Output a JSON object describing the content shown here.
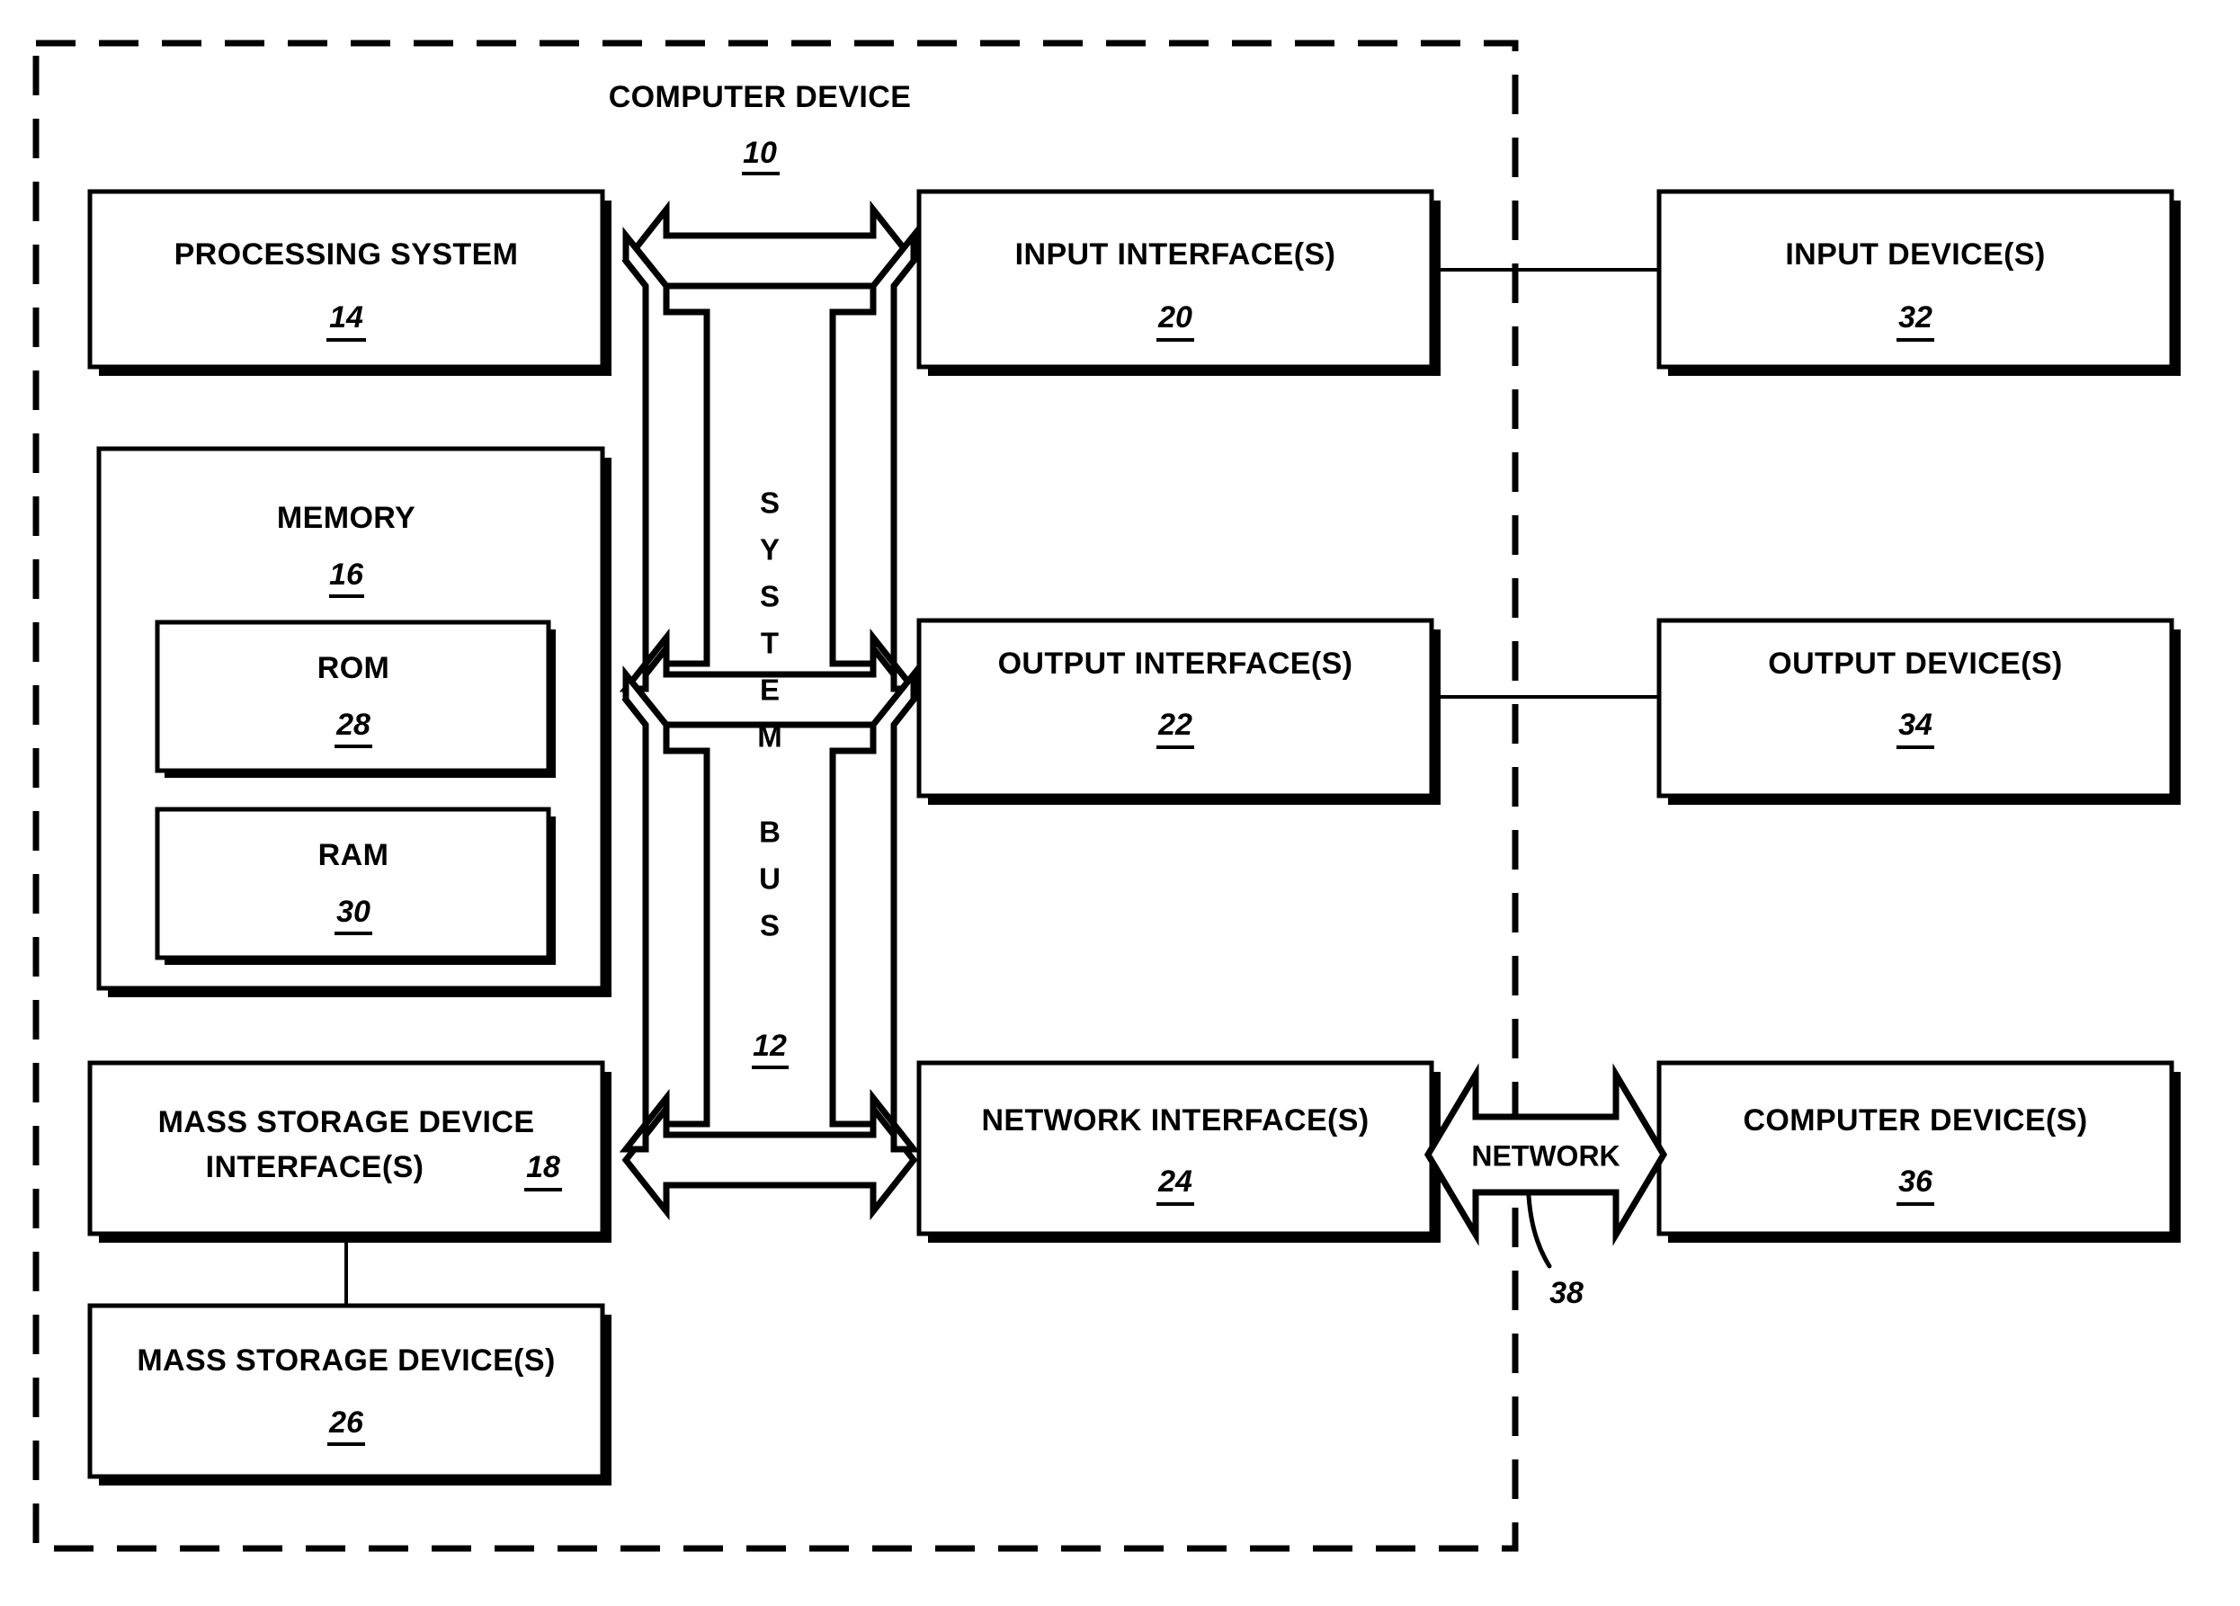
{
  "figure": {
    "title": "COMPUTER DEVICE",
    "title_ref": "10",
    "bus": {
      "label_letters": [
        "S",
        "Y",
        "S",
        "T",
        "E",
        "M",
        "",
        "B",
        "U",
        "S"
      ],
      "label_text": "SYSTEM BUS",
      "ref": "12"
    },
    "network_arrow": {
      "label": "NETWORK",
      "ref": "38"
    },
    "blocks": [
      {
        "id": "processing-system",
        "label_line1": "PROCESSING SYSTEM",
        "label_line2": "",
        "ref": "14"
      },
      {
        "id": "memory",
        "label_line1": "MEMORY",
        "label_line2": "",
        "ref": "16"
      },
      {
        "id": "rom",
        "label_line1": "ROM",
        "label_line2": "",
        "ref": "28"
      },
      {
        "id": "ram",
        "label_line1": "RAM",
        "label_line2": "",
        "ref": "30"
      },
      {
        "id": "mass-storage-device-interface",
        "label_line1": "MASS STORAGE DEVICE",
        "label_line2": "INTERFACE(S)",
        "ref": "18"
      },
      {
        "id": "mass-storage-device",
        "label_line1": "MASS STORAGE DEVICE(S)",
        "label_line2": "",
        "ref": "26"
      },
      {
        "id": "input-interface",
        "label_line1": "INPUT INTERFACE(S)",
        "label_line2": "",
        "ref": "20"
      },
      {
        "id": "output-interface",
        "label_line1": "OUTPUT INTERFACE(S)",
        "label_line2": "",
        "ref": "22"
      },
      {
        "id": "network-interface",
        "label_line1": "NETWORK INTERFACE(S)",
        "label_line2": "",
        "ref": "24"
      },
      {
        "id": "input-device",
        "label_line1": "INPUT DEVICE(S)",
        "label_line2": "",
        "ref": "32"
      },
      {
        "id": "output-device",
        "label_line1": "OUTPUT DEVICE(S)",
        "label_line2": "",
        "ref": "34"
      },
      {
        "id": "computer-devices",
        "label_line1": "COMPUTER DEVICE(S)",
        "label_line2": "",
        "ref": "36"
      }
    ],
    "colors": {
      "stroke": "#000000",
      "fill": "#ffffff"
    }
  }
}
